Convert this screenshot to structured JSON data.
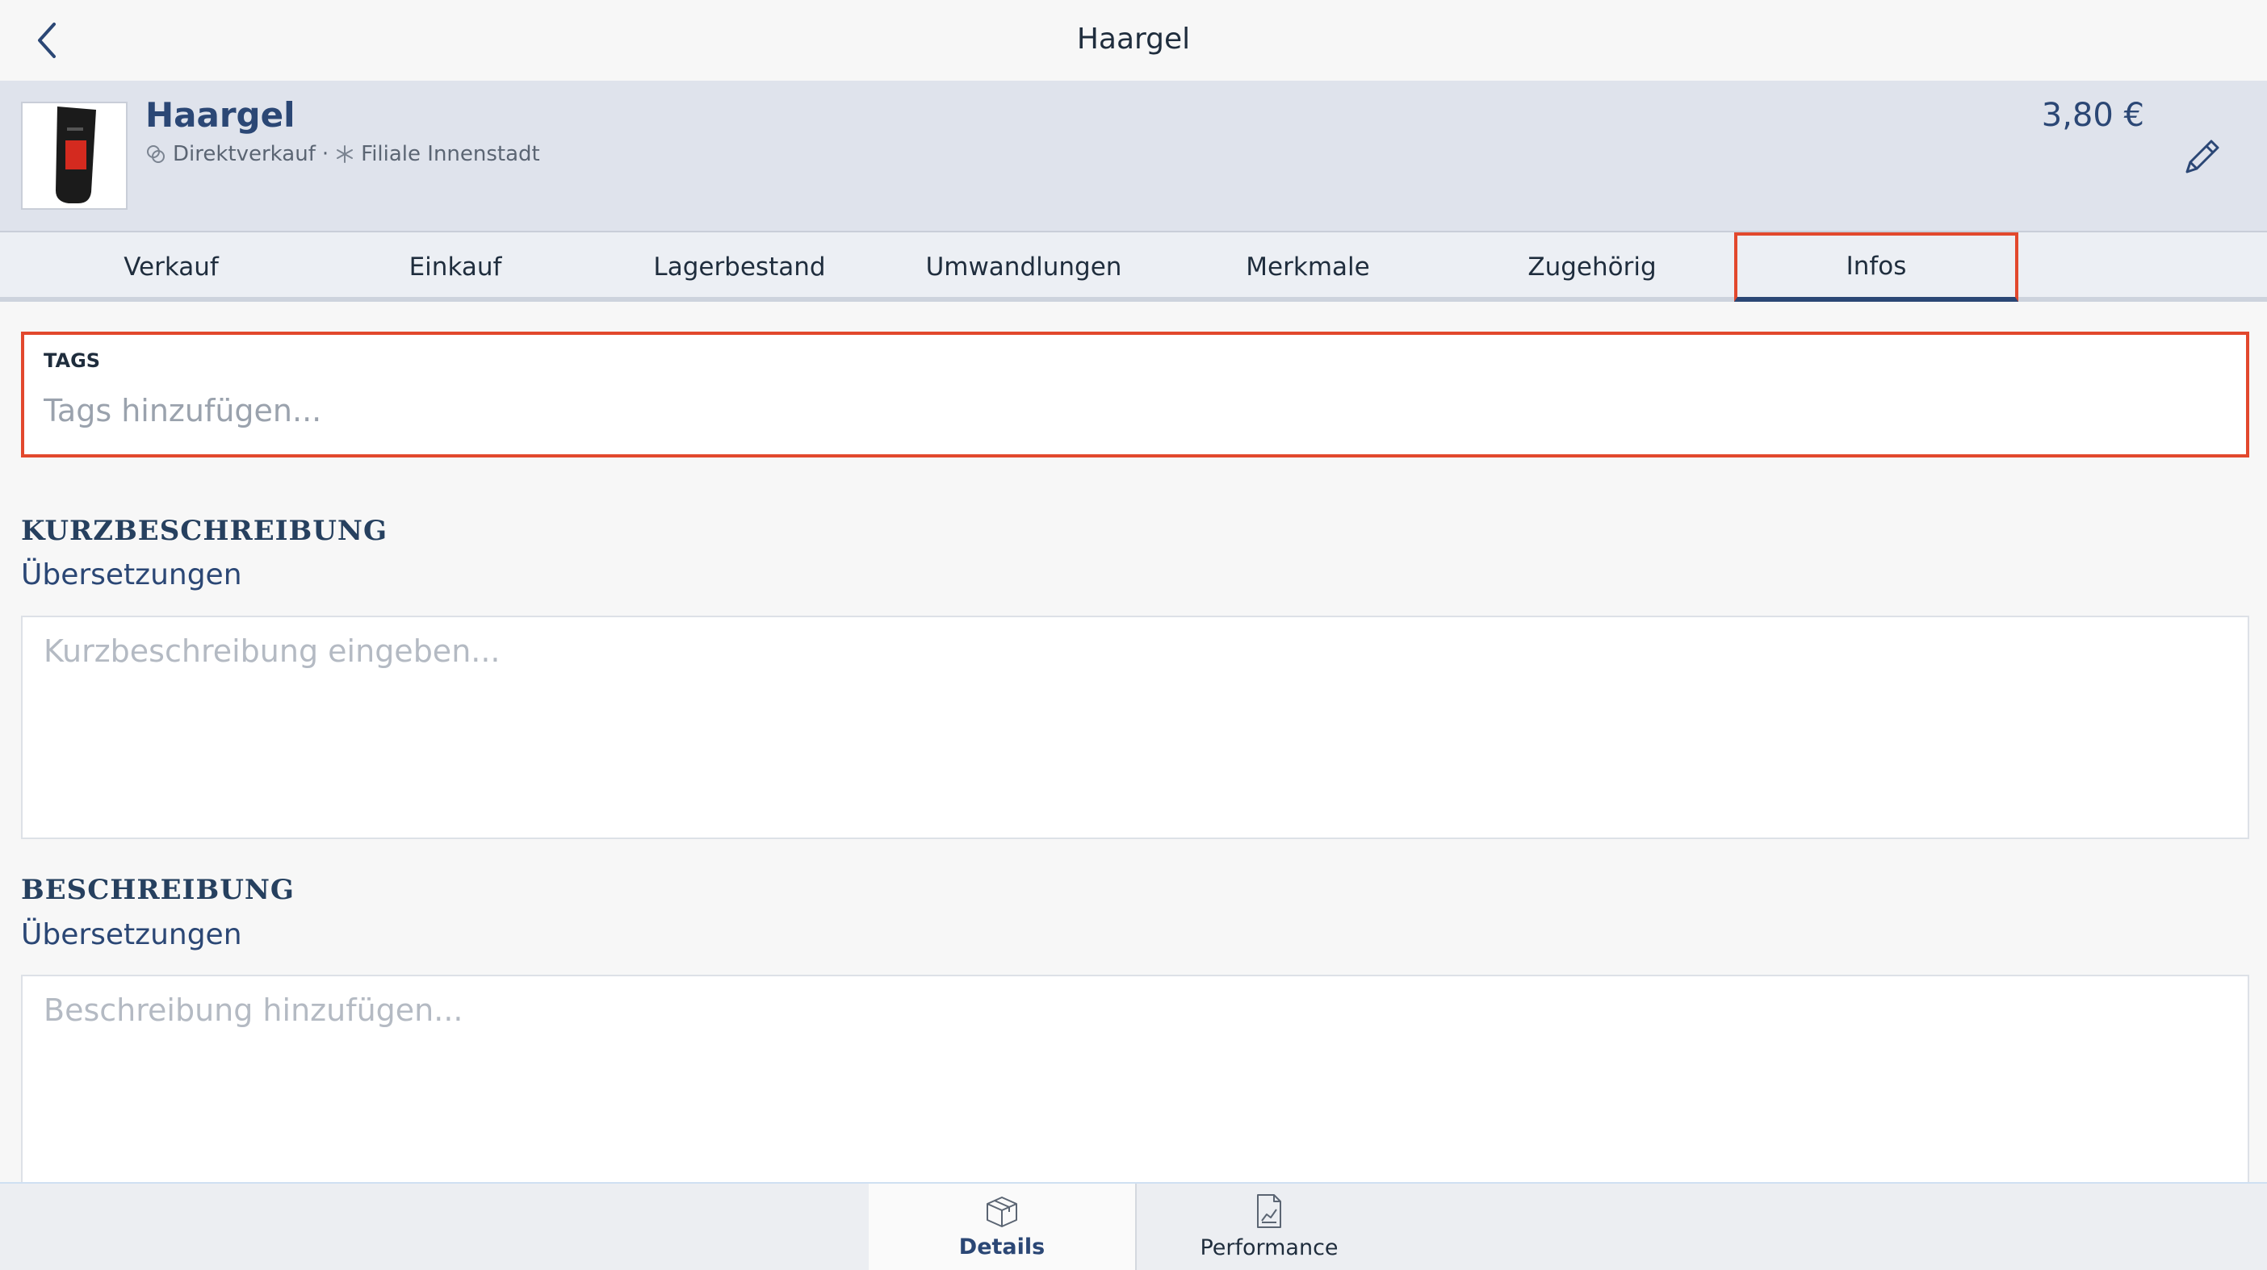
{
  "navbar": {
    "title": "Haargel"
  },
  "product": {
    "name": "Haargel",
    "type_label": "Direktverkauf",
    "separator": "·",
    "location_label": "Filiale Innenstadt",
    "price": "3,80 €"
  },
  "tabs": [
    {
      "label": "Verkauf"
    },
    {
      "label": "Einkauf"
    },
    {
      "label": "Lagerbestand"
    },
    {
      "label": "Umwandlungen"
    },
    {
      "label": "Merkmale"
    },
    {
      "label": "Zugehörig"
    },
    {
      "label": "Infos"
    }
  ],
  "active_tab": "Infos",
  "tags": {
    "label": "TAGS",
    "placeholder": "Tags hinzufügen..."
  },
  "short_description": {
    "title": "KURZBESCHREIBUNG",
    "translations_link": "Übersetzungen",
    "placeholder": "Kurzbeschreibung eingeben..."
  },
  "description": {
    "title": "BESCHREIBUNG",
    "translations_link": "Übersetzungen",
    "placeholder": "Beschreibung hinzufügen..."
  },
  "bottom_tabs": [
    {
      "label": "Details",
      "icon": "box-icon"
    },
    {
      "label": "Performance",
      "icon": "chart-document-icon"
    }
  ],
  "colors": {
    "accent": "#2b4775",
    "highlight": "#e2482d",
    "header_bg": "#dfe3ec"
  }
}
